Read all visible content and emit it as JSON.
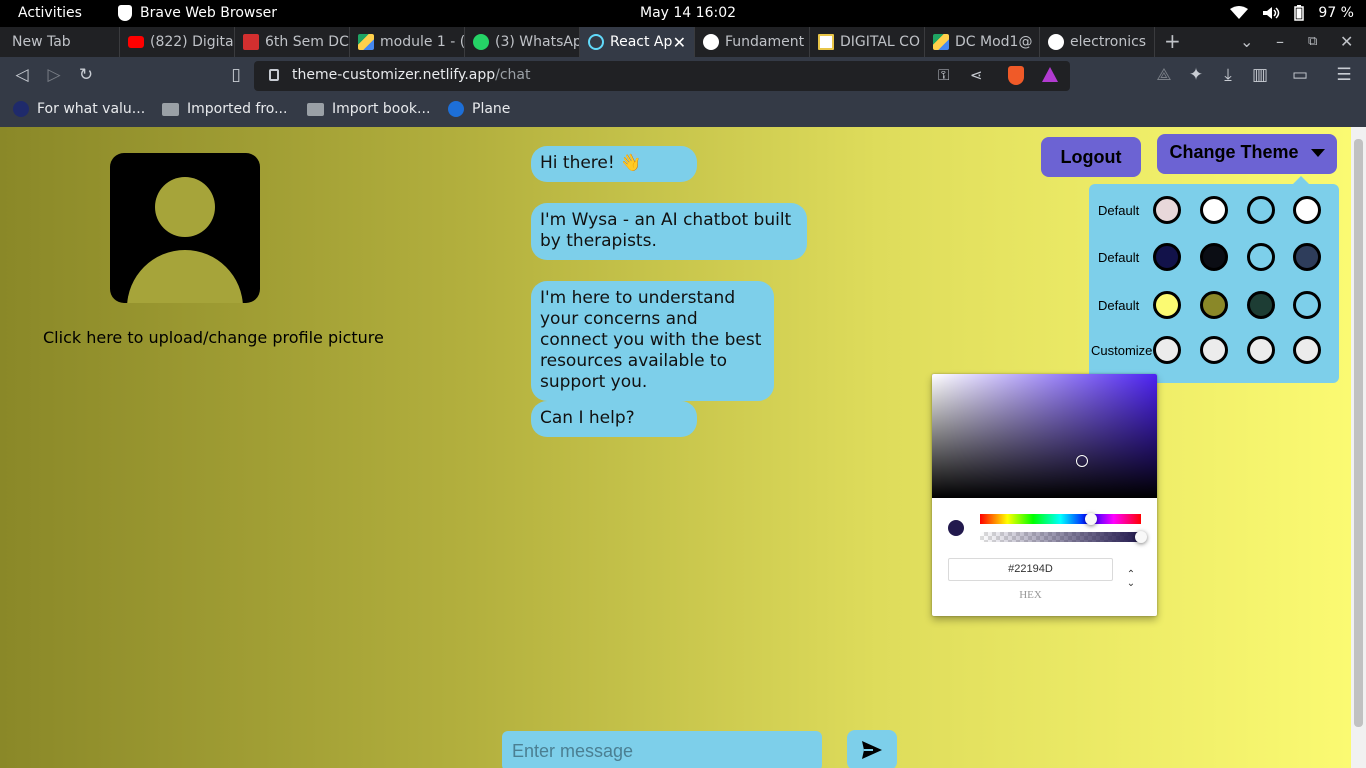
{
  "system_bar": {
    "activities": "Activities",
    "app_name": "Brave Web Browser",
    "clock": "May 14  16:02",
    "battery": "97 %"
  },
  "tabs": [
    {
      "label": "New Tab",
      "icon": "none"
    },
    {
      "label": "(822) Digita",
      "icon": "youtube-icon",
      "color": "#ff0000"
    },
    {
      "label": "6th Sem DC",
      "icon": "pdf-icon",
      "color": "#d32f2f"
    },
    {
      "label": "module 1 - (",
      "icon": "google-drive-icon",
      "color": "#1fa463"
    },
    {
      "label": "(3) WhatsAp",
      "icon": "whatsapp-icon",
      "color": "#25d366"
    },
    {
      "label": "React Ap",
      "icon": "react-icon",
      "color": "#61dafb",
      "active": true
    },
    {
      "label": "Fundament",
      "icon": "globe-icon",
      "color": "#ffffff"
    },
    {
      "label": "DIGITAL CO",
      "icon": "page-icon",
      "color": "#e8c547"
    },
    {
      "label": "DC Mod1@",
      "icon": "google-drive-icon",
      "color": "#1fa463"
    },
    {
      "label": "electronics",
      "icon": "globe-icon",
      "color": "#ffffff"
    }
  ],
  "toolbar": {
    "url_host": "theme-customizer.netlify.app",
    "url_path": "/chat"
  },
  "bookmarks": [
    {
      "label": "For what valu...",
      "icon": "link-icon"
    },
    {
      "label": "Imported fro...",
      "icon": "folder-icon"
    },
    {
      "label": "Import book...",
      "icon": "folder-icon"
    },
    {
      "label": "Plane",
      "icon": "plane-icon"
    }
  ],
  "profile": {
    "upload_label": "Click here to upload/change profile picture"
  },
  "chat": {
    "messages": [
      "Hi there! 👋",
      "I'm Wysa - an AI chatbot built by therapists.",
      "I'm here to understand your concerns and connect you with the best resources available to support you.",
      "Can I help?"
    ],
    "input_placeholder": "Enter message"
  },
  "header": {
    "logout_label": "Logout",
    "change_theme_label": "Change Theme"
  },
  "themes": [
    {
      "label": "Default",
      "colors": [
        "#e8d8da",
        "#ffffff",
        "#7dcfea",
        "#ffffff"
      ]
    },
    {
      "label": "Default",
      "colors": [
        "#12124a",
        "#0b0d14",
        "#7dcfea",
        "#2e3d5b"
      ]
    },
    {
      "label": "Default",
      "colors": [
        "#fbfa72",
        "#8a8828",
        "#1d3d34",
        "#7dcfea"
      ]
    },
    {
      "label": "Customize",
      "colors": [
        "#ececec",
        "#ececec",
        "#ececec",
        "#ececec"
      ]
    }
  ],
  "color_picker": {
    "hex_value": "#22194D",
    "mode_label": "HEX",
    "current_color": "#22194d",
    "hue": 0.69,
    "alpha": 1.0
  }
}
